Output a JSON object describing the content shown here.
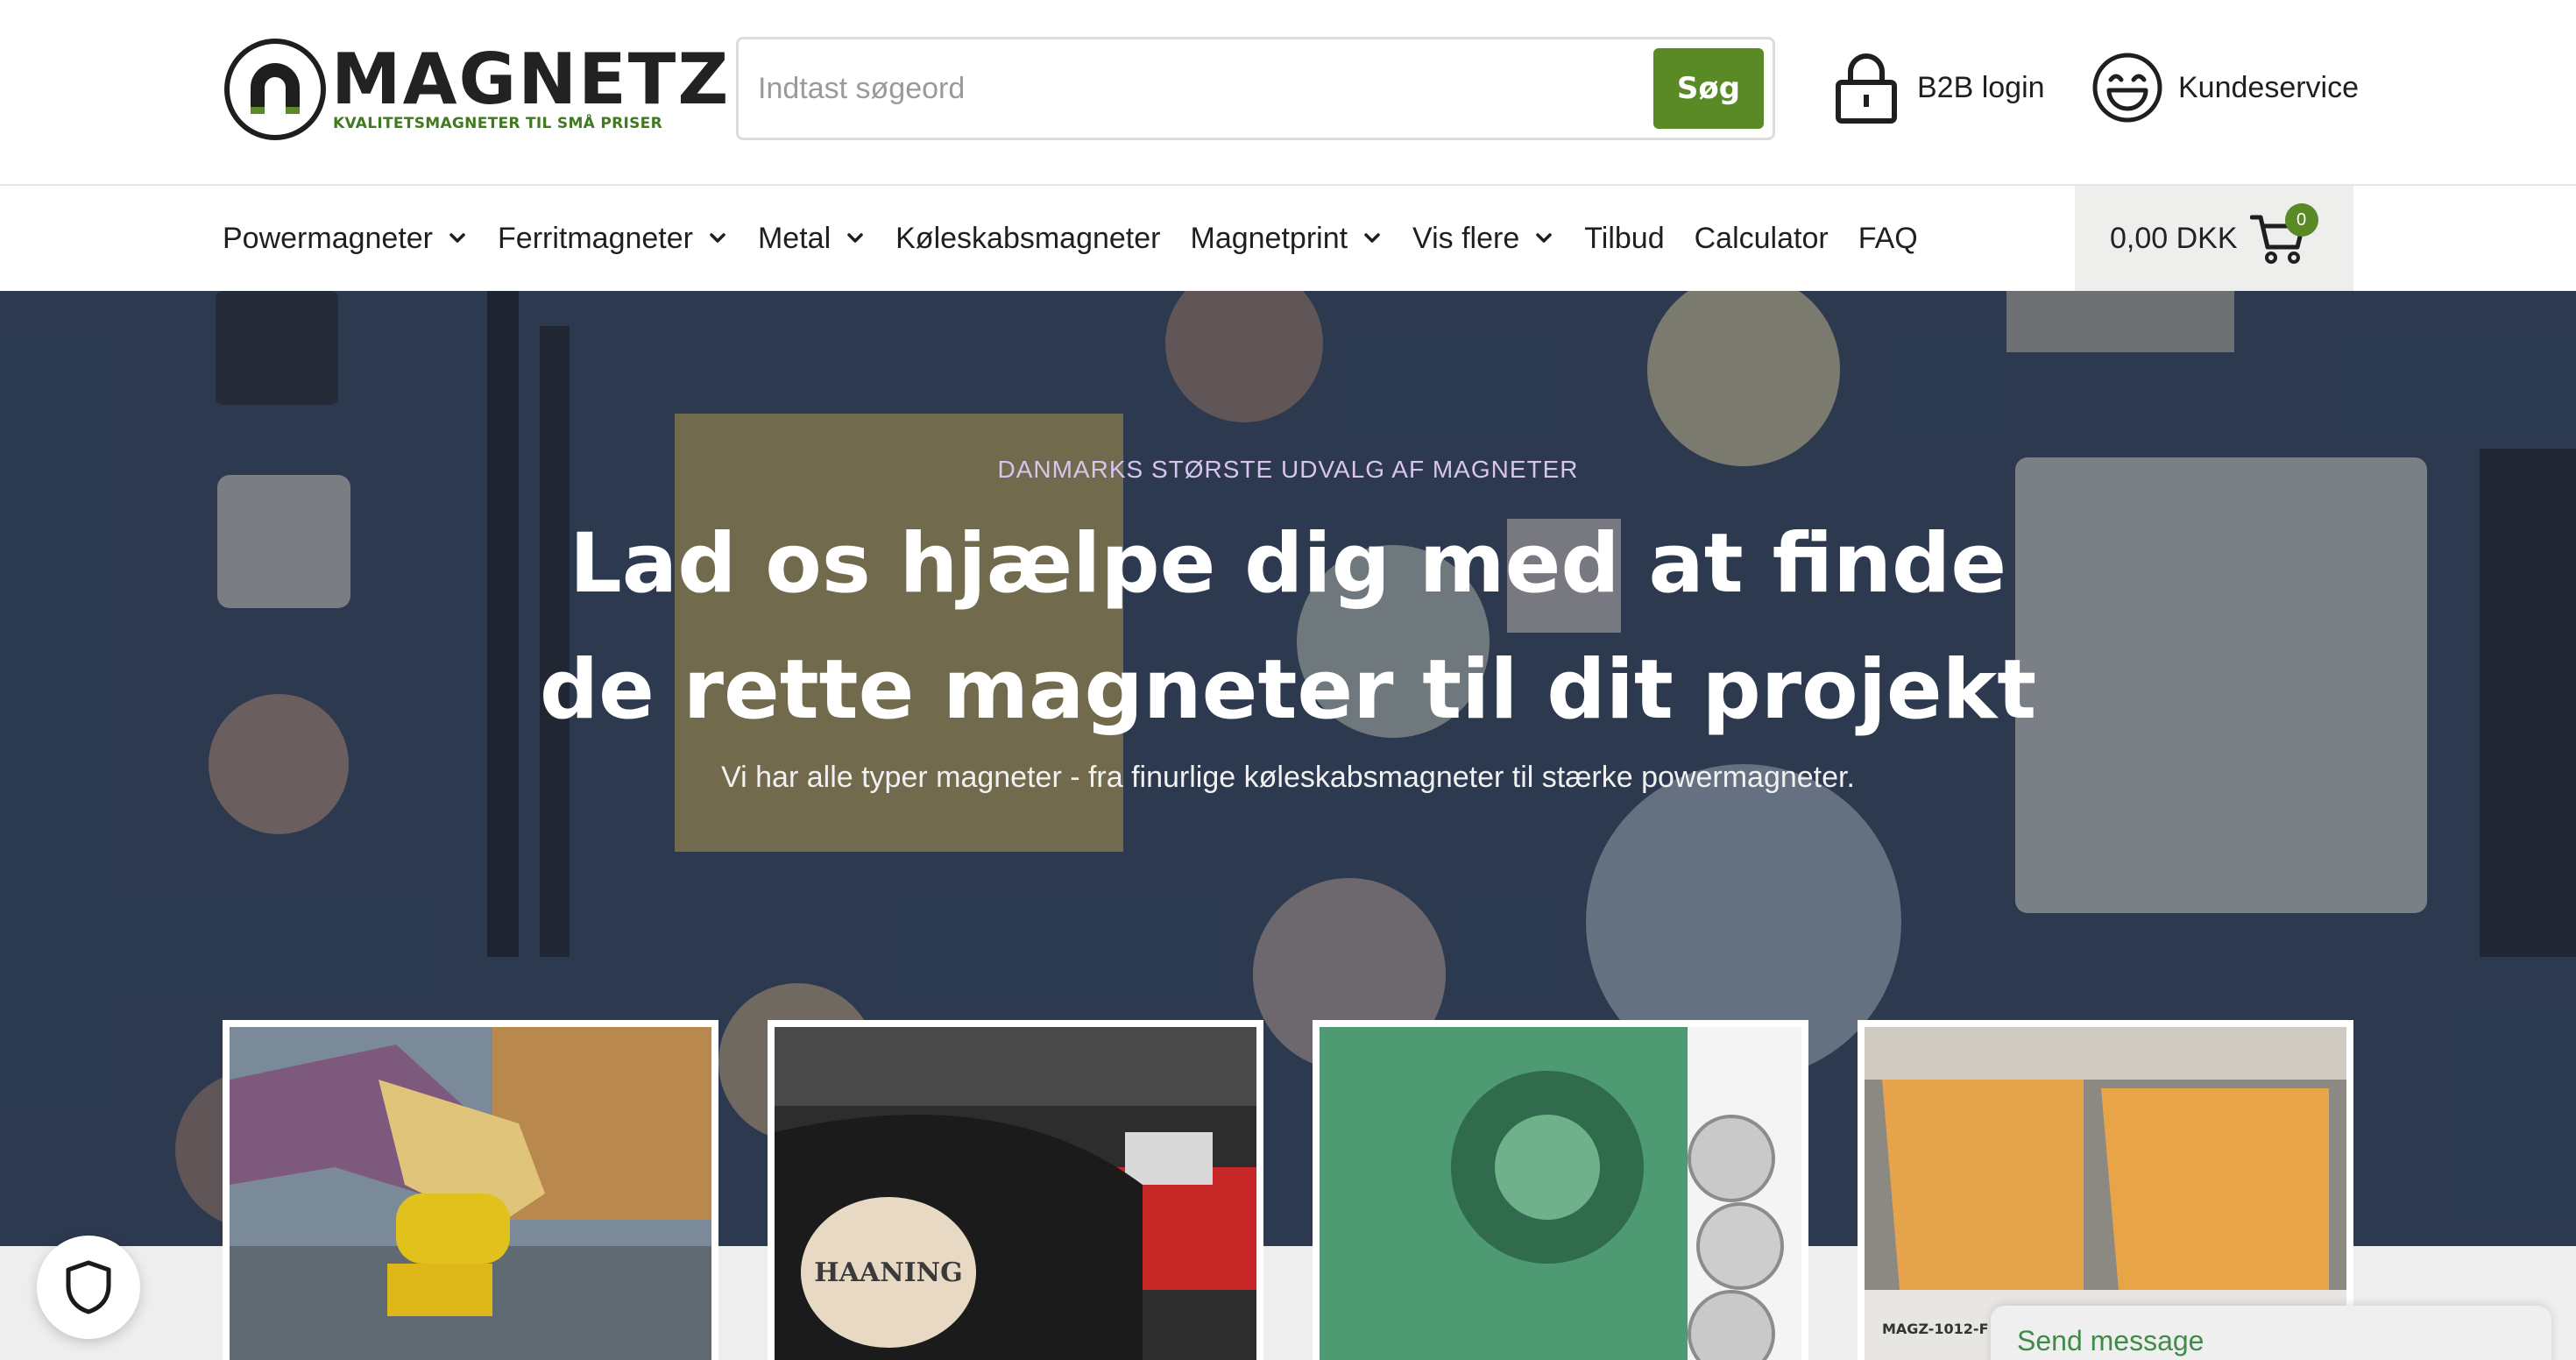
{
  "brand": {
    "name": "MAGNETZ",
    "tagline": "KVALITETSMAGNETER TIL SMÅ PRISER",
    "accent_color": "#5a8a25"
  },
  "search": {
    "placeholder": "Indtast søgeord",
    "value": "",
    "button_label": "Søg"
  },
  "header_links": {
    "b2b": {
      "label": "B2B login",
      "icon": "lock-icon"
    },
    "customer_service": {
      "label": "Kundeservice",
      "icon": "smiley-icon"
    }
  },
  "nav": {
    "items": [
      {
        "label": "Powermagneter",
        "has_dropdown": true
      },
      {
        "label": "Ferritmagneter",
        "has_dropdown": true
      },
      {
        "label": "Metal",
        "has_dropdown": true
      },
      {
        "label": "Køleskabsmagneter",
        "has_dropdown": false
      },
      {
        "label": "Magnetprint",
        "has_dropdown": true
      },
      {
        "label": "Vis flere",
        "has_dropdown": true
      },
      {
        "label": "Tilbud",
        "has_dropdown": false
      },
      {
        "label": "Calculator",
        "has_dropdown": false
      },
      {
        "label": "FAQ",
        "has_dropdown": false
      }
    ],
    "cart": {
      "total": "0,00 DKK",
      "count": "0",
      "icon": "cart-icon"
    }
  },
  "hero": {
    "kicker": "DANMARKS STØRSTE UDVALG AF MAGNETER",
    "title_line1": "Lad os hjælpe dig med at finde",
    "title_line2": "de rette magneter til dit projekt",
    "subtitle": "Vi har alle typer magneter - fra finurlige køleskabsmagneter til stærke powermagneter."
  },
  "cards": [
    {
      "image": "glove-lifting-magnet-photo"
    },
    {
      "image": "haaning-car-magnet-photo"
    },
    {
      "image": "ferrofluid-disc-magnets-photo"
    },
    {
      "image": "storage-bins-photo",
      "label_text": "MAGZ-1012-F"
    }
  ],
  "cookie_button": {
    "icon": "shield-icon"
  },
  "chat": {
    "label": "Send message"
  }
}
